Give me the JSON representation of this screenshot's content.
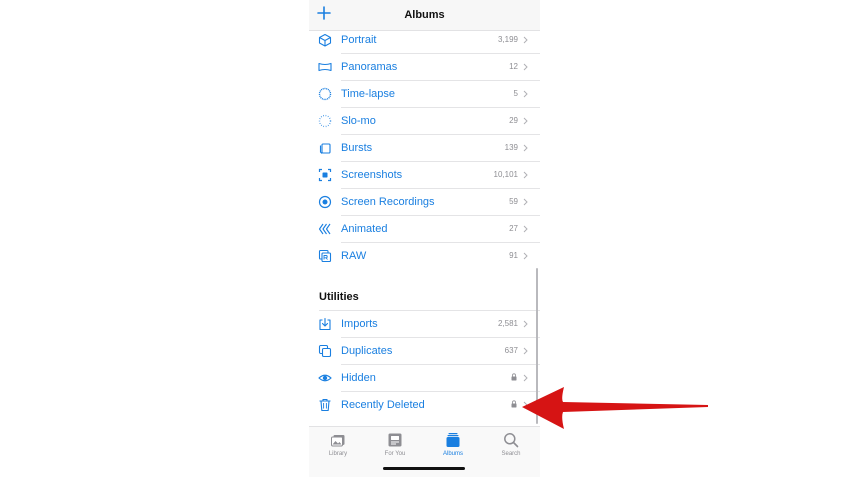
{
  "navbar": {
    "title": "Albums",
    "add_icon": "plus-icon"
  },
  "media_types": [
    {
      "label": "Portrait",
      "count": "3,199",
      "icon": "cube-icon"
    },
    {
      "label": "Panoramas",
      "count": "12",
      "icon": "panorama-icon"
    },
    {
      "label": "Time-lapse",
      "count": "5",
      "icon": "timelapse-icon"
    },
    {
      "label": "Slo-mo",
      "count": "29",
      "icon": "slomo-icon"
    },
    {
      "label": "Bursts",
      "count": "139",
      "icon": "bursts-icon"
    },
    {
      "label": "Screenshots",
      "count": "10,101",
      "icon": "screenshot-icon"
    },
    {
      "label": "Screen Recordings",
      "count": "59",
      "icon": "screen-recording-icon"
    },
    {
      "label": "Animated",
      "count": "27",
      "icon": "animated-icon"
    },
    {
      "label": "RAW",
      "count": "91",
      "icon": "raw-icon"
    }
  ],
  "utilities": {
    "title": "Utilities",
    "items": [
      {
        "label": "Imports",
        "count": "2,581",
        "icon": "import-icon"
      },
      {
        "label": "Duplicates",
        "count": "637",
        "icon": "duplicates-icon"
      },
      {
        "label": "Hidden",
        "count": "",
        "icon": "eye-icon",
        "locked": true
      },
      {
        "label": "Recently Deleted",
        "count": "",
        "icon": "trash-icon",
        "locked": true
      }
    ]
  },
  "tabbar": [
    {
      "label": "Library",
      "icon": "library-icon",
      "active": false
    },
    {
      "label": "For You",
      "icon": "for-you-icon",
      "active": false
    },
    {
      "label": "Albums",
      "icon": "albums-icon",
      "active": true
    },
    {
      "label": "Search",
      "icon": "search-icon",
      "active": false
    }
  ],
  "colors": {
    "accent": "#1a7fe0",
    "secondary_text": "#8e8e93",
    "annotation_arrow": "#d61414"
  }
}
